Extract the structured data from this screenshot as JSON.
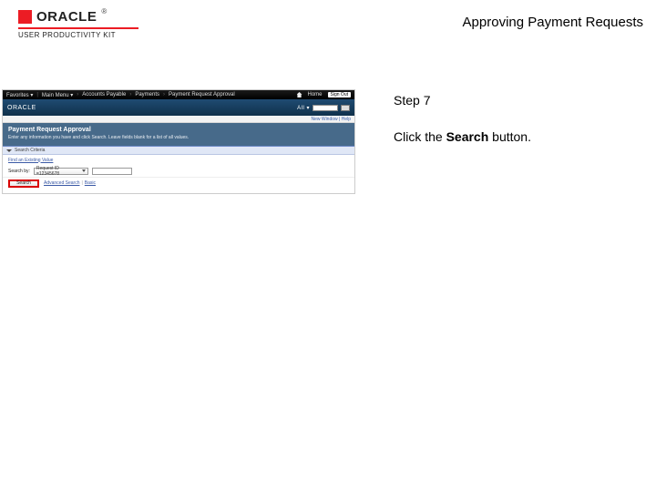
{
  "header": {
    "logo_word": "ORACLE",
    "logo_tm": "®",
    "subtitle": "USER PRODUCTIVITY KIT",
    "doc_title": "Approving Payment Requests"
  },
  "instruction": {
    "step": "Step 7",
    "line_prefix": "Click the ",
    "line_bold": "Search",
    "line_suffix": " button."
  },
  "app": {
    "nav": {
      "items": [
        "Favorites ▾",
        "Main Menu ▾",
        "Accounts Payable",
        "Payments",
        "Payment Request Approval"
      ],
      "home": "Home",
      "sign_out": "Sign Out"
    },
    "brand": "ORACLE",
    "quicksearch_label": "All ▾",
    "quicksearch_button": "››",
    "breadcrumb": "New Window | Help",
    "page_title": "Payment Request Approval",
    "page_sub": "Enter any information you have and click Search. Leave fields blank for a list of all values.",
    "search_panel": {
      "header": "Search Criteria",
      "find_link": "Find an Existing Value",
      "label": "Search by:",
      "select_value": "Request ID  =12345678",
      "input_value": ""
    },
    "actions": {
      "search": "Search",
      "advanced": "Advanced Search",
      "basic": "Basic"
    }
  }
}
